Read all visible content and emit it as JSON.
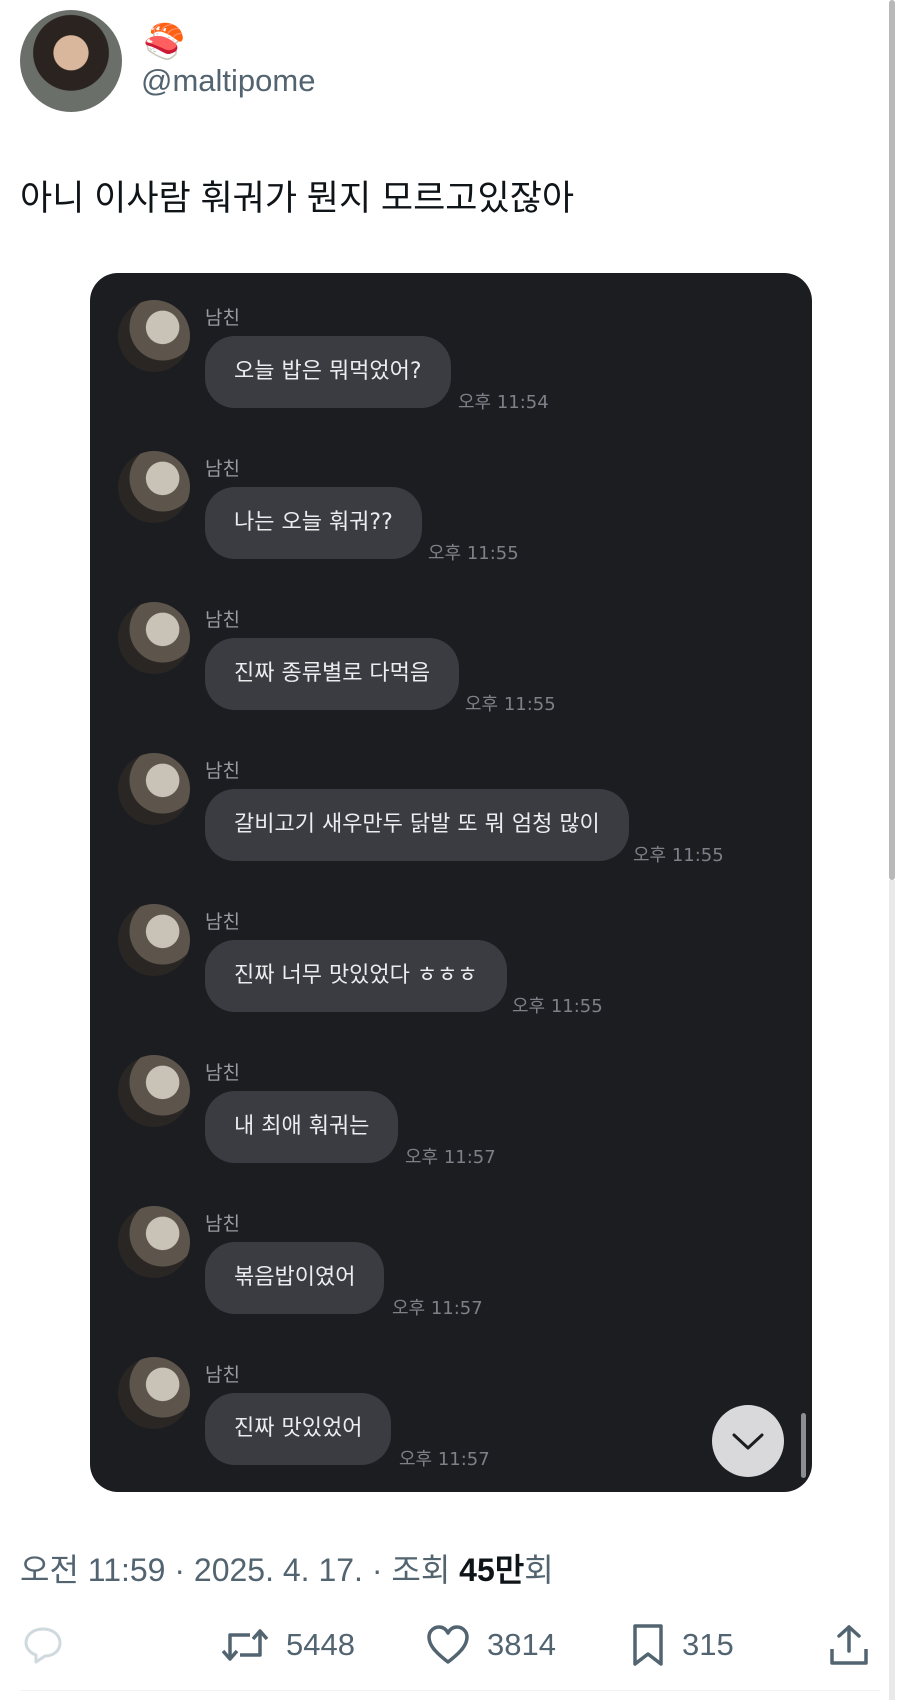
{
  "tweet": {
    "emoji": "🍣",
    "handle": "@maltipome",
    "text": "아니 이사람 훠궈가 뭔지 모르고있잖아",
    "meta_prefix": "오전 11:59 · 2025. 4. 17. · 조회 ",
    "views_count": "45만",
    "views_suffix": "회",
    "retweets": "5448",
    "likes": "3814",
    "bookmarks": "315"
  },
  "chat": {
    "messages": [
      {
        "sender": "남친",
        "text": "오늘 밥은 뭐먹었어?",
        "time": "오후 11:54"
      },
      {
        "sender": "남친",
        "text": "나는 오늘 훠궈??",
        "time": "오후 11:55"
      },
      {
        "sender": "남친",
        "text": "진짜 종류별로 다먹음",
        "time": "오후 11:55"
      },
      {
        "sender": "남친",
        "text": "갈비고기 새우만두 닭발 또 뭐 엄청 많이",
        "time": "오후 11:55"
      },
      {
        "sender": "남친",
        "text": "진짜 너무 맛있었다 ㅎㅎㅎ",
        "time": "오후 11:55"
      },
      {
        "sender": "남친",
        "text": "내 최애 훠궈는",
        "time": "오후 11:57"
      },
      {
        "sender": "남친",
        "text": "볶음밥이였어",
        "time": "오후 11:57"
      },
      {
        "sender": "남친",
        "text": "진짜 맛있었어",
        "time": "오후 11:57"
      }
    ]
  },
  "icons": {
    "reply": "reply-icon",
    "retweet": "retweet-icon",
    "like": "heart-icon",
    "bookmark": "bookmark-icon",
    "share": "share-icon",
    "scroll_down": "chevron-down-icon"
  },
  "colors": {
    "chat_bg": "#1c1d21",
    "bubble_bg": "#3a3c42",
    "muted_text": "#536471"
  }
}
